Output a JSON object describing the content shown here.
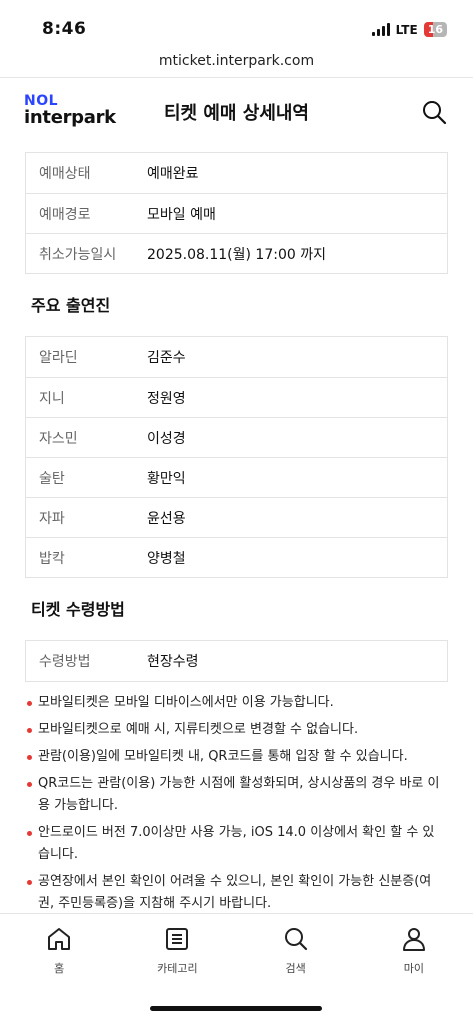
{
  "status_bar": {
    "time": "8:46",
    "network": "LTE",
    "battery": "16"
  },
  "browser": {
    "url": "mticket.interpark.com"
  },
  "header": {
    "logo_top": "NOL",
    "logo_bottom": "interpark",
    "title": "티켓 예매 상세내역",
    "search_icon": "search-icon"
  },
  "booking_info": [
    {
      "label": "예매상태",
      "value": "예매완료"
    },
    {
      "label": "예매경로",
      "value": "모바일 예매"
    },
    {
      "label": "취소가능일시",
      "value": "2025.08.11(월) 17:00 까지"
    }
  ],
  "cast": {
    "title": "주요 출연진",
    "rows": [
      {
        "label": "알라딘",
        "value": "김준수"
      },
      {
        "label": "지니",
        "value": "정원영"
      },
      {
        "label": "자스민",
        "value": "이성경"
      },
      {
        "label": "술탄",
        "value": "황만익"
      },
      {
        "label": "자파",
        "value": "윤선용"
      },
      {
        "label": "밥칵",
        "value": "양병철"
      }
    ]
  },
  "receipt": {
    "title": "티켓 수령방법",
    "rows": [
      {
        "label": "수령방법",
        "value": "현장수령"
      }
    ]
  },
  "notices": [
    "모바일티켓은 모바일 디바이스에서만 이용 가능합니다.",
    "모바일티켓으로 예매 시, 지류티켓으로 변경할 수 없습니다.",
    "관람(이용)일에 모바일티켓 내, QR코드를 통해 입장 할 수 있습니다.",
    "QR코드는 관람(이용) 가능한 시점에 활성화되며, 상시상품의 경우 바로 이용 가능합니다.",
    "안드로이드 버전 7.0이상만 사용 가능, iOS 14.0 이상에서 확인 할 수 있습니다.",
    "공연장에서 본인 확인이 어려울 수 있으니, 본인 확인이 가능한 신분증(여권, 주민등록증)을 지참해 주시기 바랍니다."
  ],
  "nav": [
    {
      "label": "홈",
      "icon": "home-icon"
    },
    {
      "label": "카테고리",
      "icon": "category-icon"
    },
    {
      "label": "검색",
      "icon": "search-icon"
    },
    {
      "label": "마이",
      "icon": "user-icon"
    }
  ],
  "colors": {
    "brand_blue": "#2b44ff",
    "bullet_red": "#e53935"
  }
}
